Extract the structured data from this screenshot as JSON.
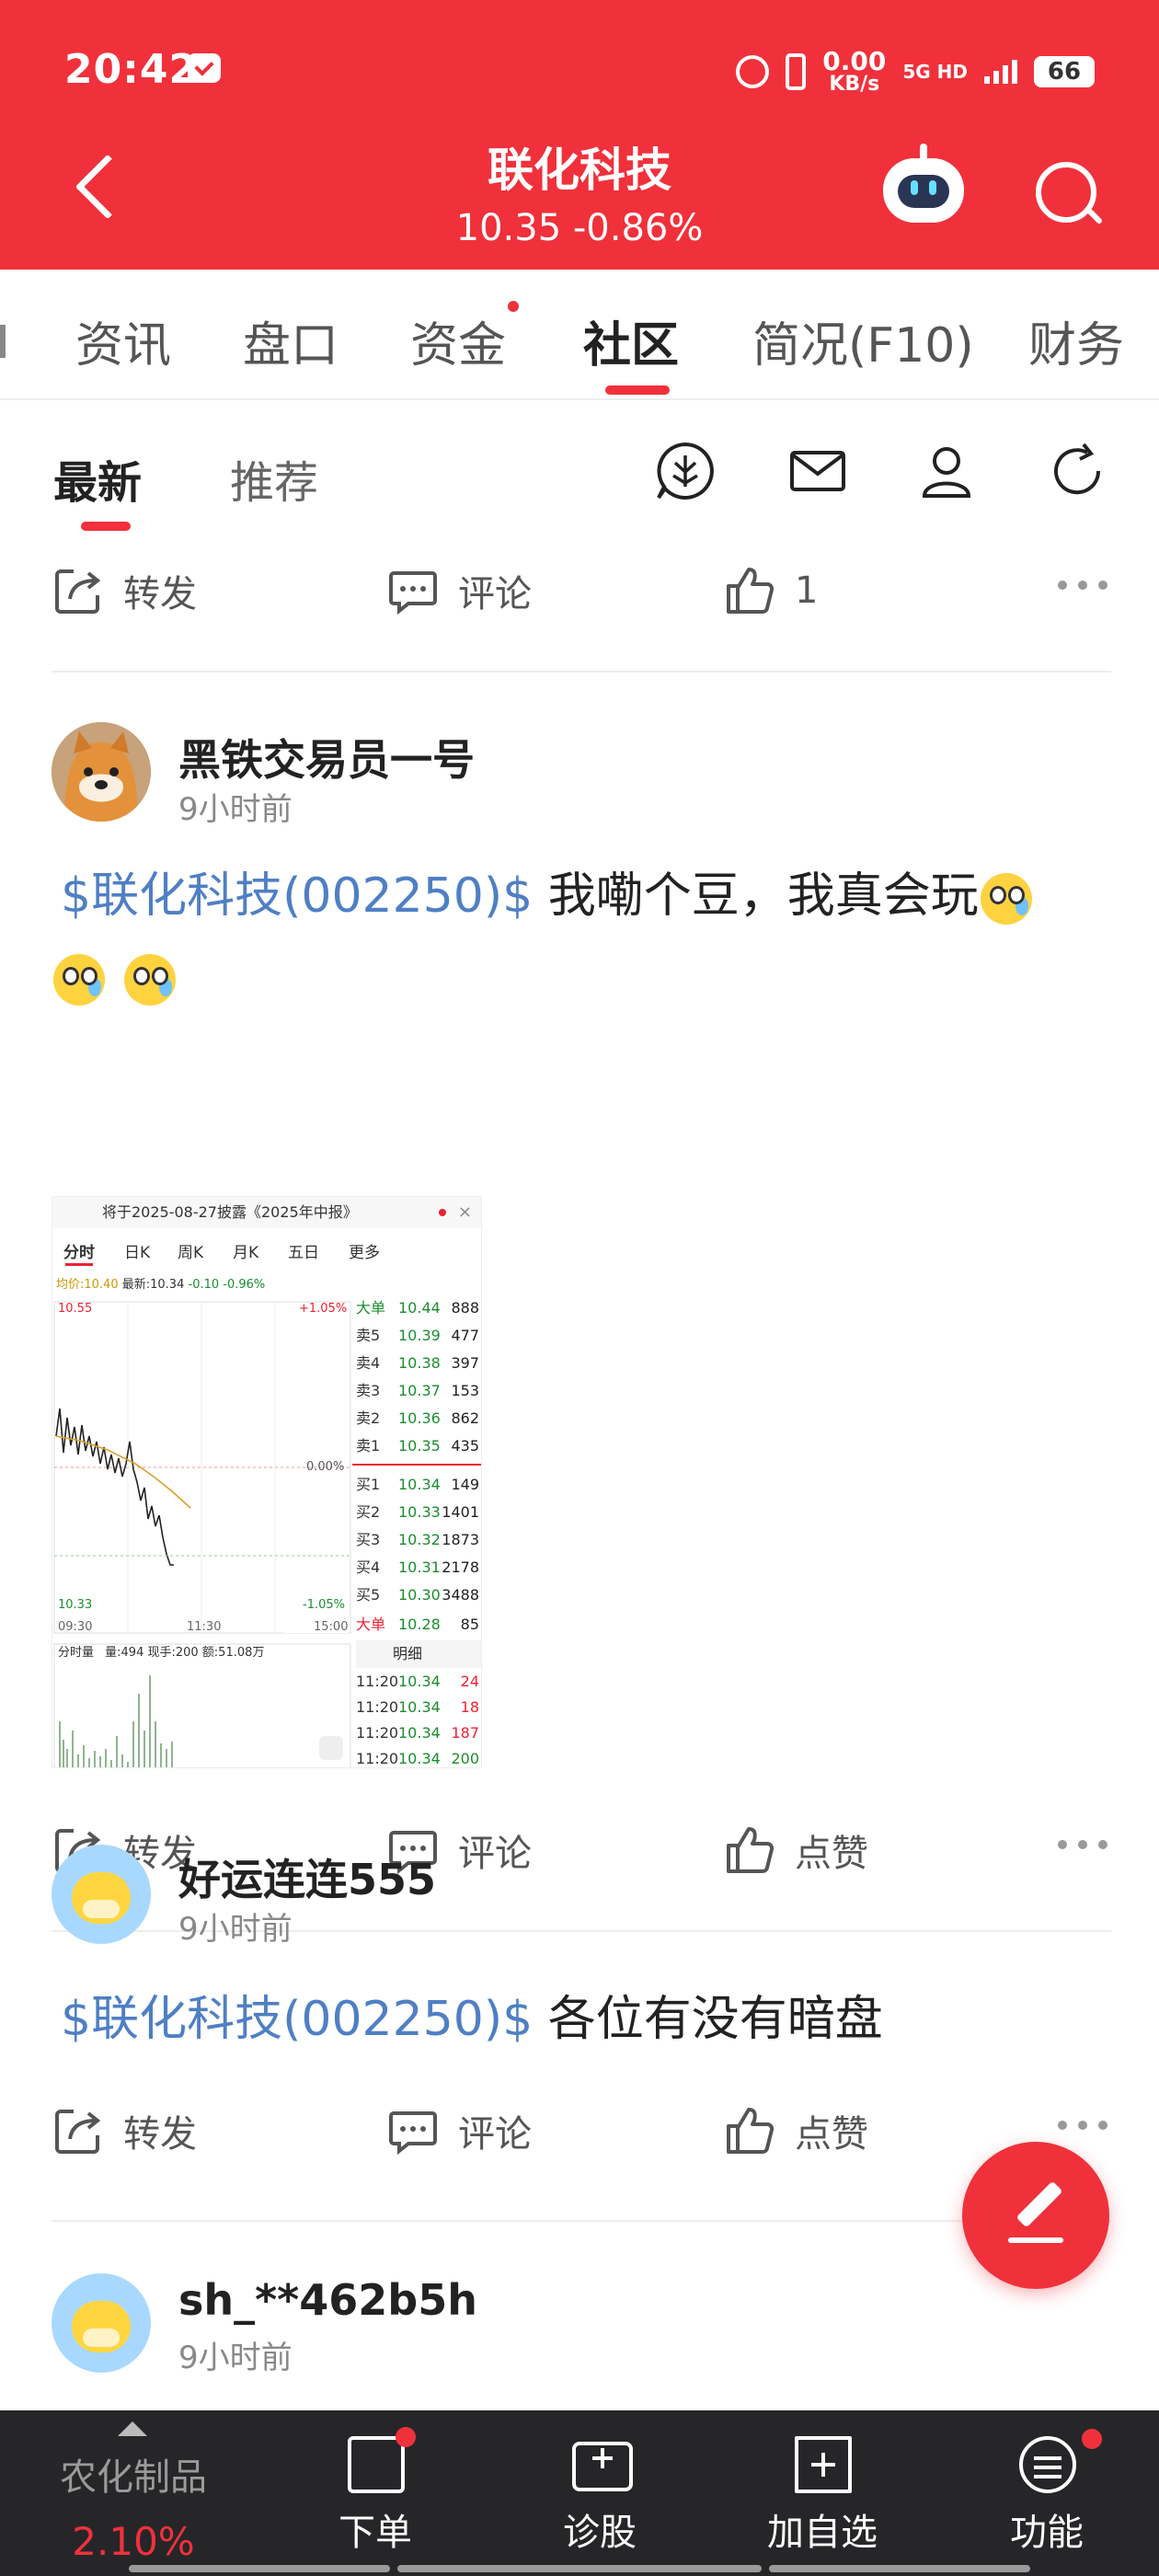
{
  "status_bar": {
    "time": "20:42",
    "net_speed": "0.00",
    "net_unit": "KB/s",
    "network": "5G HD",
    "battery": "66"
  },
  "header": {
    "title": "联化科技",
    "price": "10.35",
    "change": "-0.86%"
  },
  "tabs": [
    "资讯",
    "盘口",
    "资金",
    "社区",
    "简况(F10)",
    "财务"
  ],
  "tab_active": "社区",
  "subtabs": {
    "latest": "最新",
    "recommend": "推荐"
  },
  "actions": {
    "repost": "转发",
    "comment": "评论",
    "like": "点赞",
    "like_count_first": "1"
  },
  "posts": [
    {
      "author": "黑铁交易员一号",
      "time": "9小时前",
      "stock_tag": "$联化科技(002250)$",
      "text": "我嘞个豆，我真会玩"
    },
    {
      "author": "好运连连555",
      "time": "9小时前",
      "stock_tag": "$联化科技(002250)$",
      "text": "各位有没有暗盘"
    },
    {
      "author": "sh_**462b5h",
      "time": "9小时前"
    }
  ],
  "stock_image": {
    "header": "将于2025-08-27披露《2025年中报》",
    "tabs": [
      "分时",
      "日K",
      "周K",
      "月K",
      "五日",
      "更多"
    ],
    "avg_label": "均价:10.40",
    "latest_label": "最新:10.34",
    "chg_label": "-0.10",
    "pct_label": "-0.96%",
    "top_price": "10.55",
    "top_pct": "+1.05%",
    "mid_pct": "0.00%",
    "low_price": "10.33",
    "low_pct": "-1.05%",
    "times": [
      "09:30",
      "11:30",
      "15:00"
    ],
    "vol_label": "分时量",
    "vol_info": "量:494 现手:200 额:51.08万",
    "big_label": "大单",
    "big_top": {
      "price": "10.44",
      "vol": "888"
    },
    "asks": [
      {
        "label": "卖5",
        "price": "10.39",
        "vol": "477"
      },
      {
        "label": "卖4",
        "price": "10.38",
        "vol": "397"
      },
      {
        "label": "卖3",
        "price": "10.37",
        "vol": "153"
      },
      {
        "label": "卖2",
        "price": "10.36",
        "vol": "862"
      },
      {
        "label": "卖1",
        "price": "10.35",
        "vol": "435"
      }
    ],
    "bids": [
      {
        "label": "买1",
        "price": "10.34",
        "vol": "149"
      },
      {
        "label": "买2",
        "price": "10.33",
        "vol": "1401"
      },
      {
        "label": "买3",
        "price": "10.32",
        "vol": "1873"
      },
      {
        "label": "买4",
        "price": "10.31",
        "vol": "2178"
      },
      {
        "label": "买5",
        "price": "10.30",
        "vol": "3488"
      }
    ],
    "big_bottom": {
      "price": "10.28",
      "vol": "85"
    },
    "detail_label": "明细",
    "ticks": [
      {
        "time": "11:20",
        "price": "10.34",
        "vol": "24"
      },
      {
        "time": "11:20",
        "price": "10.34",
        "vol": "18"
      },
      {
        "time": "11:20",
        "price": "10.34",
        "vol": "187"
      },
      {
        "time": "11:20",
        "price": "10.34",
        "vol": "200"
      }
    ]
  },
  "bottom_bar": {
    "market_name": "农化制品",
    "market_pct": "2.10%",
    "items": [
      "下单",
      "诊股",
      "加自选",
      "功能"
    ]
  },
  "colors": {
    "brand_red": "#f0313b",
    "link_blue": "#4f7fc4",
    "bar_dark": "#262629"
  }
}
